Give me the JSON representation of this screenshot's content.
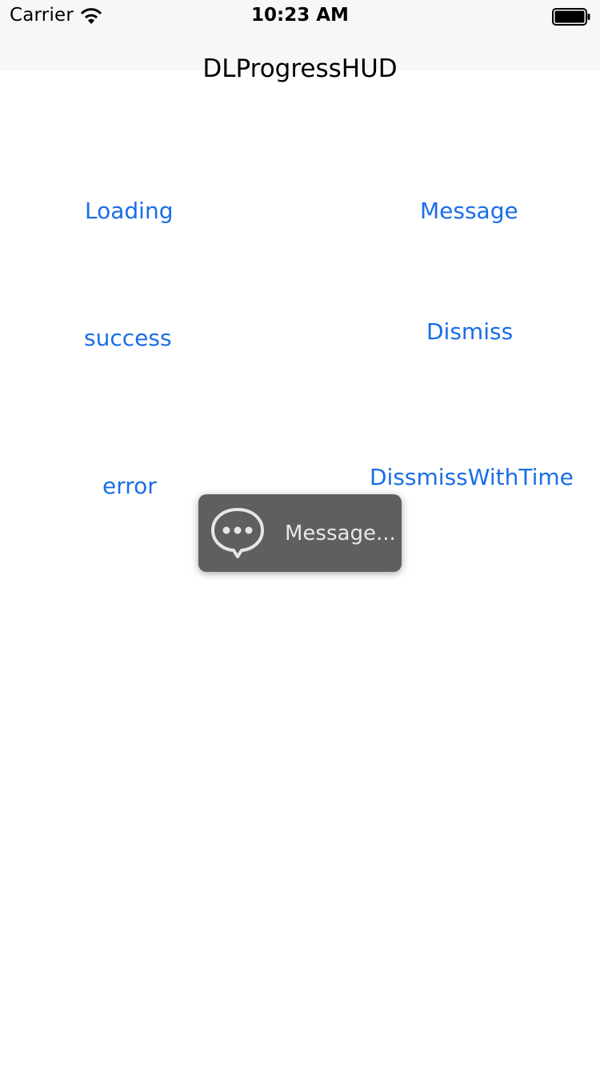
{
  "status_bar": {
    "carrier": "Carrier",
    "time": "10:23 AM",
    "wifi_icon": "wifi-icon",
    "battery_icon": "battery-icon"
  },
  "nav": {
    "title": "DLProgressHUD"
  },
  "buttons": {
    "loading": "Loading",
    "message": "Message",
    "success": "success",
    "dismiss": "Dismiss",
    "error": "error",
    "dismiss_with_time": "DissmissWithTime"
  },
  "hud": {
    "icon": "message-bubble-icon",
    "text": "Message..."
  },
  "colors": {
    "accent": "#1a6ee6",
    "hud_background": "#5f5f5f",
    "nav_background": "#f7f7f7"
  }
}
